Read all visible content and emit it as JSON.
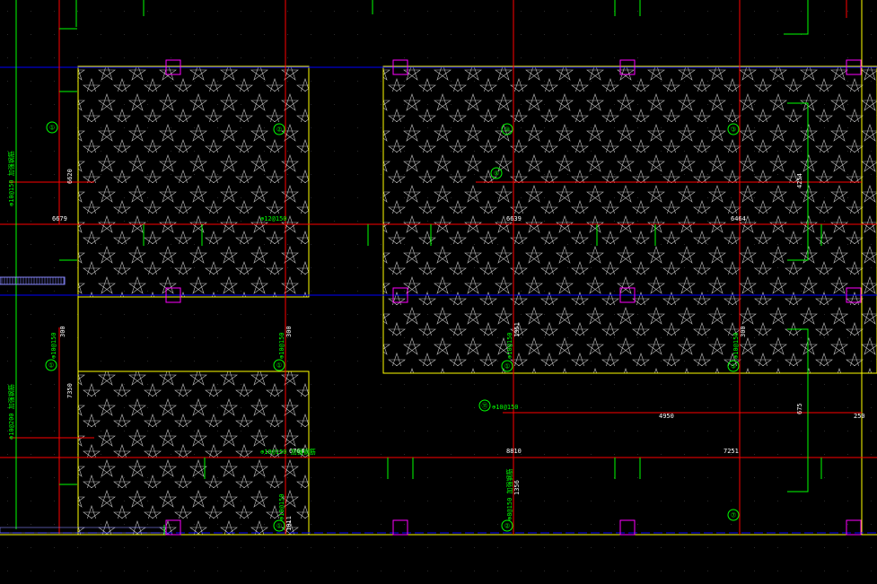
{
  "app": {
    "name": "CAD drawing viewport"
  },
  "colors": {
    "background": "#000000",
    "slab_outline": "#ffff00",
    "hatch": "#bfbfbf",
    "rebar_main": "#ff0000",
    "rebar_dim": "#00ff00",
    "axis": "#0000ff",
    "column": "#ff00ff",
    "grid_dot": "#2a2a2a"
  },
  "hatch_pattern": "star-hatch",
  "dimensions": {
    "d1": "6620",
    "d2": "6679",
    "d3": "6639",
    "d4": "6464",
    "d5": "4254",
    "d6": "300",
    "d7": "300",
    "d8": "1351",
    "d9": "300",
    "d10": "7350",
    "d11": "6764",
    "d12": "8810",
    "d13": "7251",
    "d14": "4950",
    "d15": "675",
    "d16": "250",
    "d17": "1011",
    "d18": "1356"
  },
  "annotations": {
    "a1": "⊕10@150 加强钢筋",
    "a2": "⊕10@200 加强钢筋",
    "a3": "⊕12@150",
    "a4": "⊕10@150",
    "a5": "⊕10@150",
    "a6": "⊕10@150",
    "a7": "⊕10@150 加强钢筋",
    "a8": "⊕10@150",
    "a9": "⊕10@150",
    "a10": "⊕10@150",
    "a11": "⊕8@150 加强钢筋"
  },
  "markers": {
    "m1": "①",
    "m2": "①",
    "m3": "②",
    "m4": "⑨",
    "m5": "⑩",
    "m6": "①",
    "m7": "①",
    "m8": "⑪",
    "m9": "③",
    "m10": "③",
    "m11": "①",
    "m12": "②",
    "m13": "⑦"
  }
}
